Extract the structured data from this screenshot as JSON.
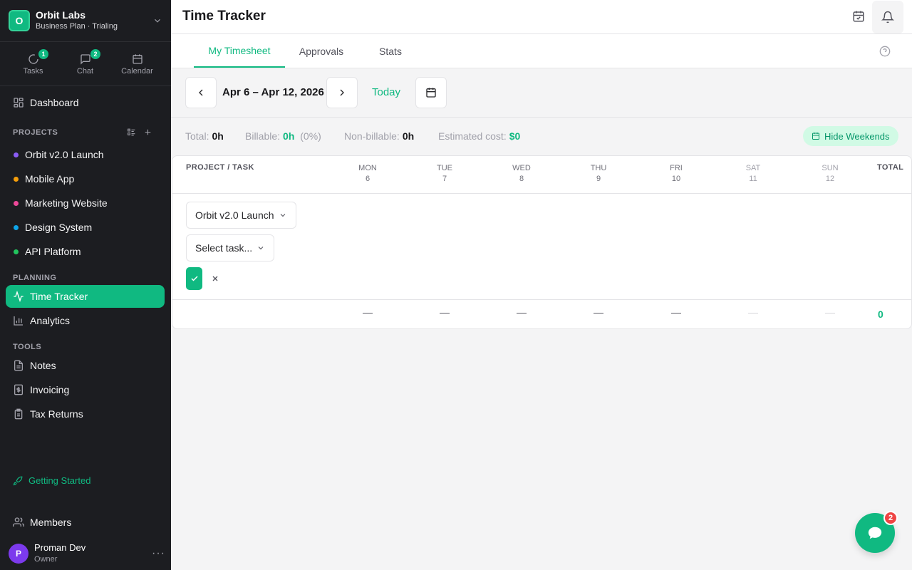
{
  "workspace": {
    "initial": "O",
    "name": "Orbit Labs",
    "plan": "Business Plan · Trialing"
  },
  "quick": [
    {
      "label": "Tasks",
      "badge": "1"
    },
    {
      "label": "Chat",
      "badge": "2"
    },
    {
      "label": "Calendar"
    }
  ],
  "nav": {
    "dashboard": "Dashboard",
    "projects_header": "PROJECTS",
    "projects": [
      {
        "label": "Orbit v2.0 Launch",
        "color": "#8b5cf6"
      },
      {
        "label": "Mobile App",
        "color": "#f59e0b"
      },
      {
        "label": "Marketing Website",
        "color": "#ec4899"
      },
      {
        "label": "Design System",
        "color": "#0ea5e9"
      },
      {
        "label": "API Platform",
        "color": "#22c55e"
      }
    ],
    "planning_header": "PLANNING",
    "time_tracker": "Time Tracker",
    "analytics": "Analytics",
    "tools_header": "TOOLS",
    "notes": "Notes",
    "invoicing": "Invoicing",
    "tax_returns": "Tax Returns",
    "getting_started": "Getting Started",
    "members": "Members"
  },
  "user": {
    "initial": "P",
    "name": "Proman Dev",
    "role": "Owner",
    "more": "···"
  },
  "header": {
    "title": "Time Tracker"
  },
  "tabs": [
    "My Timesheet",
    "Approvals",
    "Stats"
  ],
  "datebar": {
    "range": "Apr 6 – Apr 12, 2026",
    "today": "Today"
  },
  "summary": {
    "total_label": "Total:",
    "total": "0h",
    "billable_label": "Billable:",
    "billable": "0h",
    "billable_pct": "(0%)",
    "nonbillable_label": "Non-billable:",
    "nonbillable": "0h",
    "cost_label": "Estimated cost:",
    "cost": "$0",
    "hide_weekends": "Hide Weekends"
  },
  "table": {
    "project_header": "PROJECT / TASK",
    "total_header": "TOTAL",
    "days": [
      {
        "dow": "MON",
        "date": "6"
      },
      {
        "dow": "TUE",
        "date": "7"
      },
      {
        "dow": "WED",
        "date": "8"
      },
      {
        "dow": "THU",
        "date": "9"
      },
      {
        "dow": "FRI",
        "date": "10"
      },
      {
        "dow": "SAT",
        "date": "11"
      },
      {
        "dow": "SUN",
        "date": "12"
      }
    ],
    "project_select": "Orbit v2.0 Launch",
    "task_select": "Select task...",
    "empty": "—",
    "total": "0"
  },
  "fab": {
    "badge": "2"
  },
  "colors": {
    "accent": "#10b981",
    "sidebar": "#1c1d21",
    "badge_red": "#ef4444"
  }
}
